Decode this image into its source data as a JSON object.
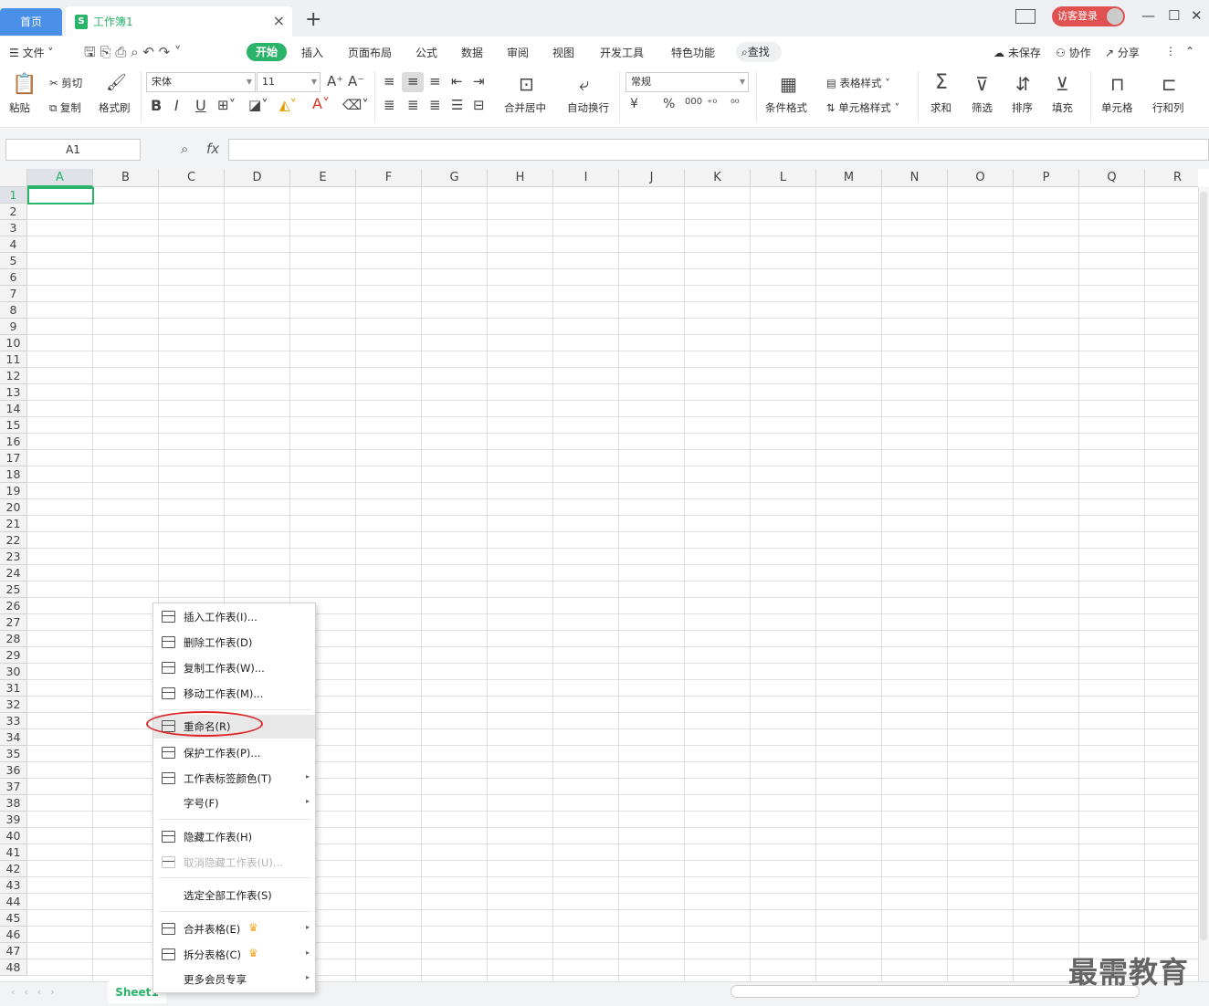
{
  "titlebar": {
    "home_tab": "首页",
    "doc_tab": "工作簿1",
    "doc_icon_letter": "S",
    "add_tab": "+",
    "close_tab": "×",
    "guest_login": "访客登录",
    "win_minimize": "—",
    "win_maximize": "☐",
    "win_close": "✕"
  },
  "menubar": {
    "file": "文件",
    "items": [
      "开始",
      "插入",
      "页面布局",
      "公式",
      "数据",
      "审阅",
      "视图",
      "开发工具",
      "特色功能"
    ],
    "find": "查找",
    "unsaved": "未保存",
    "collab": "协作",
    "share": "分享"
  },
  "ribbon": {
    "paste": "粘贴",
    "cut": "剪切",
    "copy": "复制",
    "format_painter": "格式刷",
    "font_name": "宋体",
    "font_size": "11",
    "bold": "B",
    "italic": "I",
    "underline": "U",
    "merge_center": "合并居中",
    "auto_wrap": "自动换行",
    "number_format": "常规",
    "currency": "¥",
    "percent": "%",
    "thousands": "000",
    "cond_format": "条件格式",
    "table_style": "表格样式",
    "cell_style": "单元格样式",
    "sum": "求和",
    "filter": "筛选",
    "sort": "排序",
    "fill": "填充",
    "cell": "单元格",
    "row_col": "行和列"
  },
  "formula": {
    "name_box": "A1",
    "fx": "fx"
  },
  "grid": {
    "columns": [
      "A",
      "B",
      "C",
      "D",
      "E",
      "F",
      "G",
      "H",
      "I",
      "J",
      "K",
      "L",
      "M",
      "N",
      "O",
      "P",
      "Q",
      "R"
    ],
    "rows": [
      "1",
      "2",
      "3",
      "4",
      "5",
      "6",
      "7",
      "8",
      "9",
      "10",
      "11",
      "12",
      "13",
      "14",
      "15",
      "16",
      "17",
      "18",
      "19",
      "20",
      "21",
      "22",
      "23",
      "24",
      "25",
      "26",
      "27",
      "28",
      "29",
      "30",
      "31",
      "32",
      "33",
      "34",
      "35",
      "36",
      "37",
      "38",
      "39",
      "40",
      "41",
      "42",
      "43",
      "44",
      "45",
      "46",
      "47",
      "48"
    ]
  },
  "sheetbar": {
    "sheet_name": "Sheet1"
  },
  "context_menu": {
    "items": [
      {
        "label": "插入工作表(I)...",
        "has_arrow": false,
        "disabled": false
      },
      {
        "label": "删除工作表(D)",
        "has_arrow": false,
        "disabled": false
      },
      {
        "label": "复制工作表(W)...",
        "has_arrow": false,
        "disabled": false
      },
      {
        "label": "移动工作表(M)...",
        "has_arrow": false,
        "disabled": false
      },
      {
        "label": "重命名(R)",
        "has_arrow": false,
        "disabled": false
      },
      {
        "label": "保护工作表(P)...",
        "has_arrow": false,
        "disabled": false
      },
      {
        "label": "工作表标签颜色(T)",
        "has_arrow": true,
        "disabled": false
      },
      {
        "label": "字号(F)",
        "has_arrow": true,
        "disabled": false
      },
      {
        "label": "隐藏工作表(H)",
        "has_arrow": false,
        "disabled": false
      },
      {
        "label": "取消隐藏工作表(U)...",
        "has_arrow": false,
        "disabled": true
      },
      {
        "label": "选定全部工作表(S)",
        "has_arrow": false,
        "disabled": false
      },
      {
        "label": "合并表格(E)",
        "has_arrow": true,
        "disabled": false
      },
      {
        "label": "拆分表格(C)",
        "has_arrow": true,
        "disabled": false
      },
      {
        "label": "更多会员专享",
        "has_arrow": true,
        "disabled": false
      }
    ],
    "arrow": "▸",
    "crown": "♛"
  },
  "watermark": "最需教育",
  "colors": {
    "accent": "#2bb36a",
    "home_tab": "#4a8fe8",
    "guest": "#e05252",
    "highlight_oval": "#e02828"
  }
}
